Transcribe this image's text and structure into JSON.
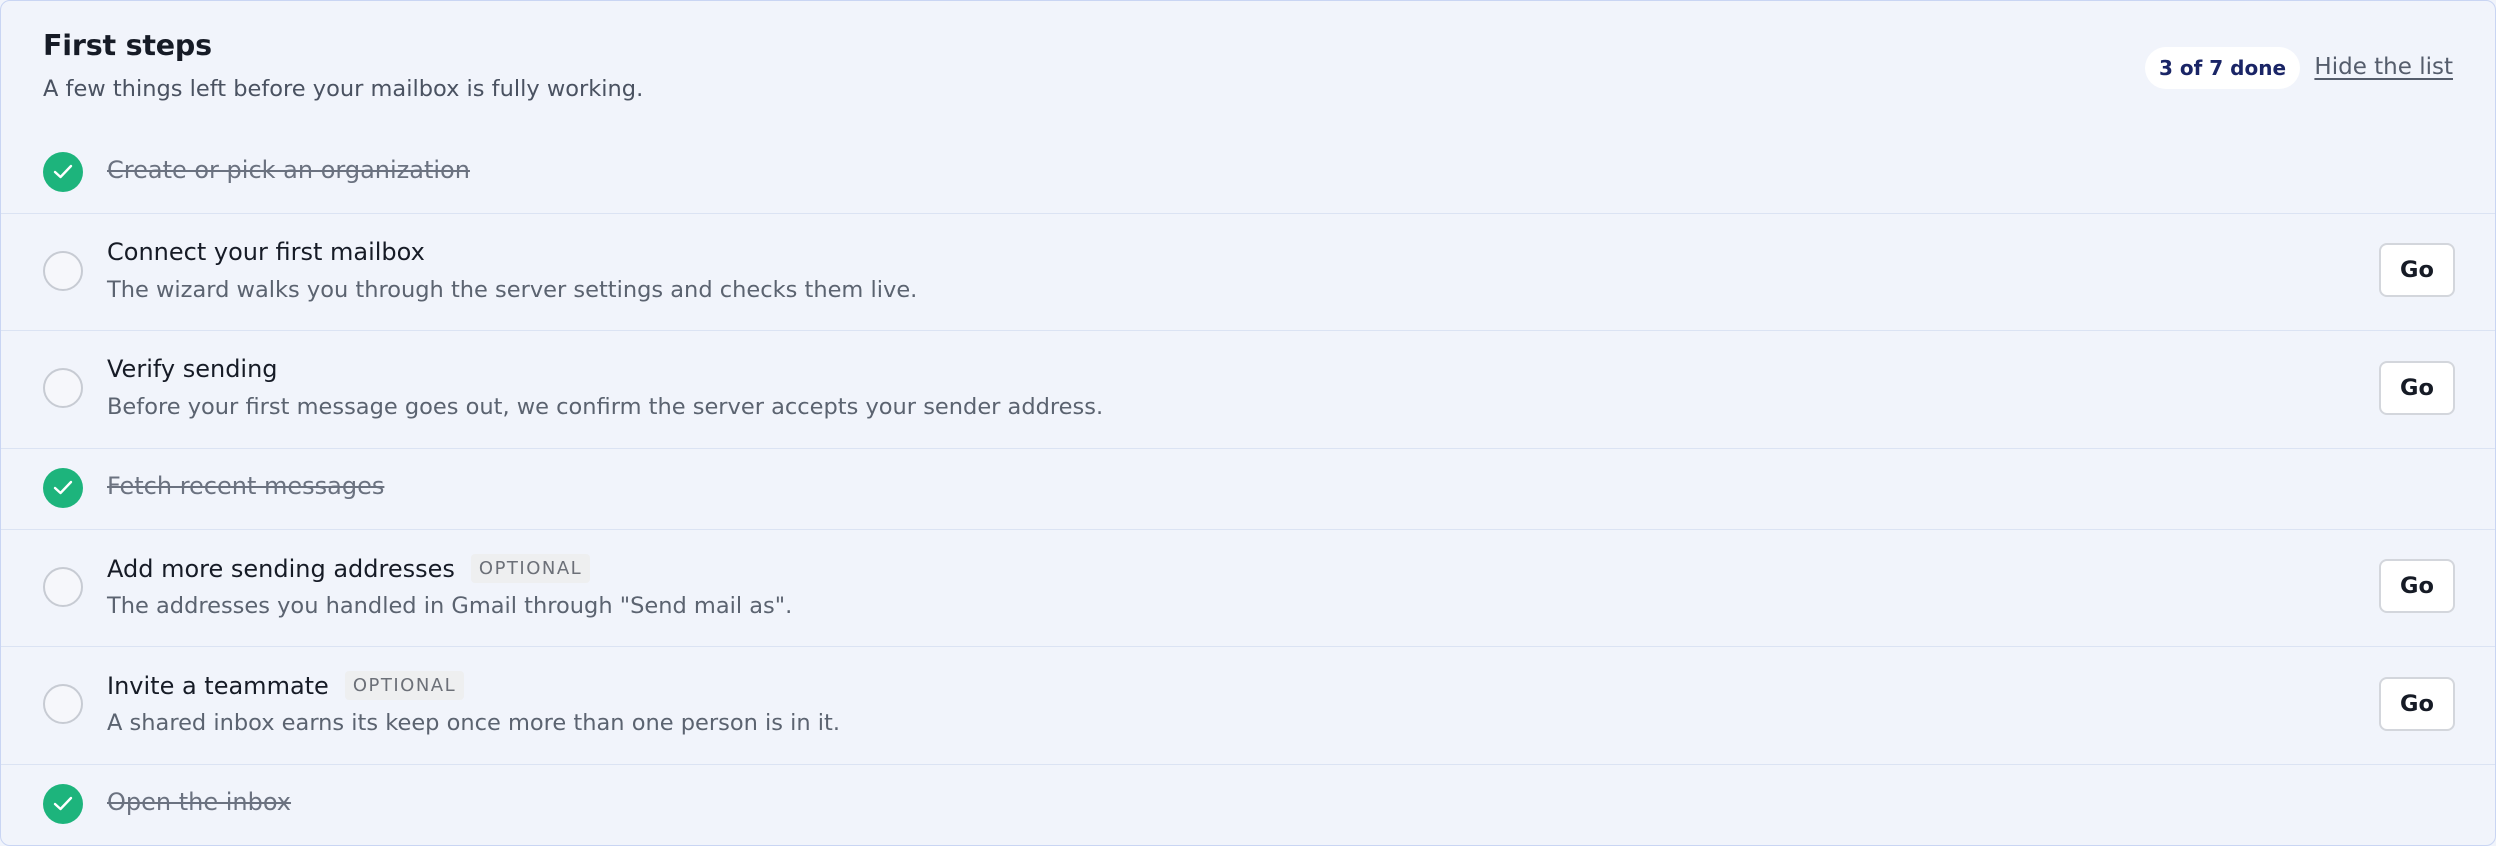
{
  "header": {
    "title": "First steps",
    "subtitle": "A few things left before your mailbox is fully working.",
    "progress": "3 of 7 done",
    "hide_label": "Hide the list"
  },
  "steps": [
    {
      "title": "Create or pick an organization",
      "done": true
    },
    {
      "title": "Connect your first mailbox",
      "description": "The wizard walks you through the server settings and checks them live.",
      "done": false,
      "action": "Go"
    },
    {
      "title": "Verify sending",
      "description": "Before your first message goes out, we confirm the server accepts your sender address.",
      "done": false,
      "action": "Go"
    },
    {
      "title": "Fetch recent messages",
      "done": true
    },
    {
      "title": "Add more sending addresses",
      "badge": "OPTIONAL",
      "description": "The addresses you handled in Gmail through \"Send mail as\".",
      "done": false,
      "action": "Go"
    },
    {
      "title": "Invite a teammate",
      "badge": "OPTIONAL",
      "description": "A shared inbox earns its keep once more than one person is in it.",
      "done": false,
      "action": "Go"
    },
    {
      "title": "Open the inbox",
      "done": true
    }
  ],
  "colors": {
    "done_check": "#1db47c",
    "badge_text": "#1a2566",
    "background": "#f1f4fb"
  },
  "icons": {
    "done": "check-icon",
    "todo": "empty-circle-icon"
  }
}
